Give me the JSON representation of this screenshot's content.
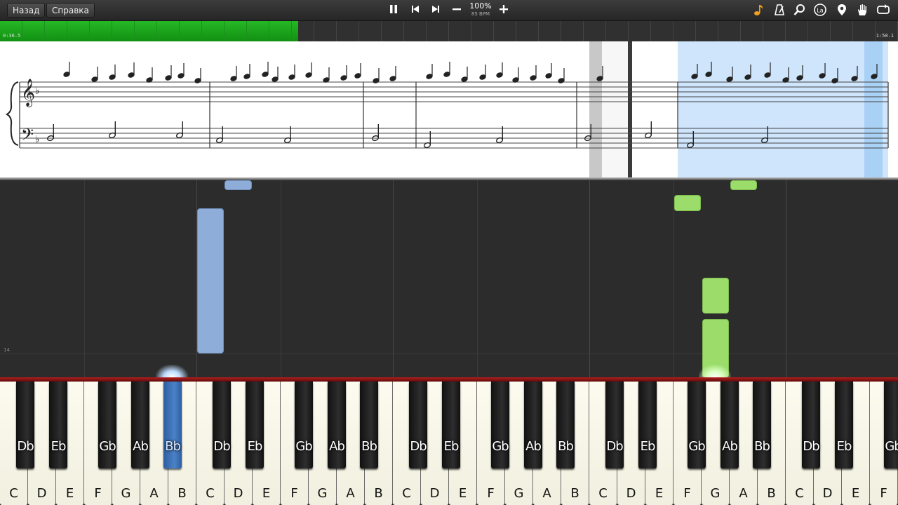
{
  "toolbar": {
    "back_label": "Назад",
    "help_label": "Справка",
    "zoom": "100%",
    "bpm": "85 BPM"
  },
  "progress": {
    "current_time": "0:36.5",
    "total_time": "1:50.1",
    "fraction": 0.332
  },
  "lanes": {
    "measure_label": "14"
  },
  "colors": {
    "left_hand": "#8eaed9",
    "right_hand": "#9bdc6a",
    "pressed_key": "#2f66b0",
    "progress": "#1ba01b",
    "highlight": "#cfe5fb"
  },
  "keyboard": {
    "white_labels": [
      "C",
      "D",
      "E",
      "F",
      "G",
      "A",
      "B",
      "C",
      "D",
      "E",
      "F",
      "G",
      "A",
      "B",
      "C",
      "D",
      "E",
      "F",
      "G",
      "A",
      "B",
      "C",
      "D",
      "E",
      "F",
      "G",
      "A",
      "B",
      "C",
      "D",
      "E",
      "F"
    ],
    "black_labels": [
      "Db",
      "Eb",
      "Gb",
      "Ab",
      "Bb",
      "Db",
      "Eb",
      "Gb",
      "Ab",
      "Bb",
      "Db",
      "Eb",
      "Gb",
      "Ab",
      "Bb",
      "Db",
      "Eb",
      "Gb",
      "Ab",
      "Bb",
      "Db",
      "Eb",
      "Gb"
    ],
    "pressed_label": "Bb"
  }
}
